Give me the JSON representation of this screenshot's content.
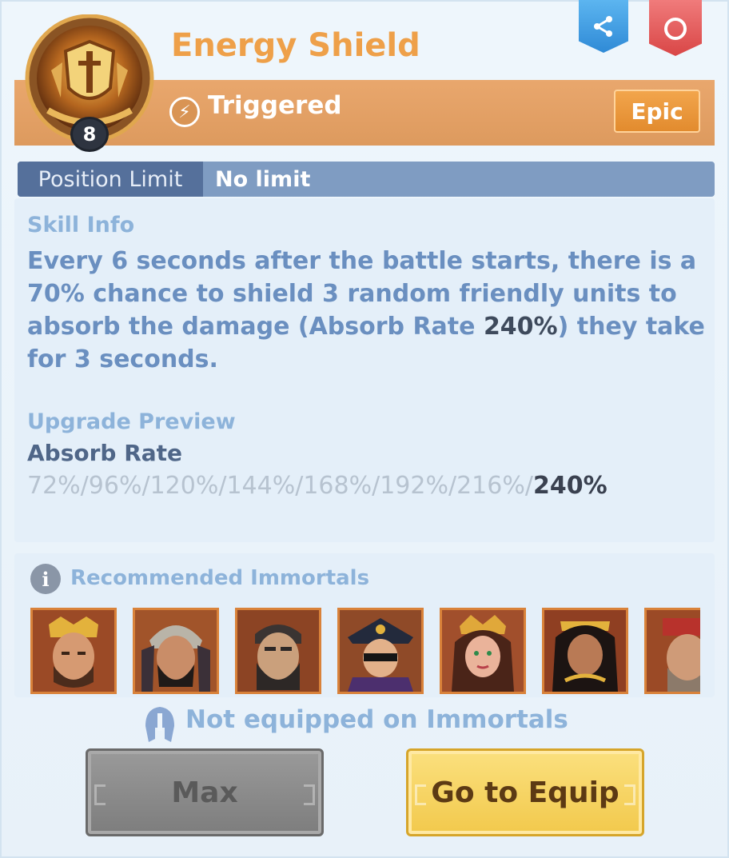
{
  "header": {
    "title": "Energy Shield",
    "trigger_type": "Triggered",
    "rarity": "Epic",
    "level": "8",
    "share_icon": "share-icon",
    "power_icon": "power-icon"
  },
  "position": {
    "label": "Position Limit",
    "value": "No limit"
  },
  "skill_info": {
    "heading": "Skill Info",
    "desc_part1": "Every 6 seconds after the battle starts, there is a 70% chance to shield 3 random friendly units to absorb the damage (Absorb Rate ",
    "desc_highlight": "240%",
    "desc_part2": ") they take for 3 seconds."
  },
  "upgrade": {
    "heading": "Upgrade Preview",
    "stat_name": "Absorb Rate",
    "values_prefix": "72%/96%/120%/144%/168%/192%/216%/",
    "values_final": "240%"
  },
  "recommended": {
    "heading": "Recommended Immortals",
    "portraits": [
      "immortal-1",
      "immortal-2",
      "immortal-3",
      "immortal-4",
      "immortal-5",
      "immortal-6",
      "immortal-7"
    ]
  },
  "footer": {
    "status": "Not equipped on Immortals",
    "max_label": "Max",
    "equip_label": "Go to Equip"
  },
  "colors": {
    "title": "#eea049",
    "band": "#e9a76d",
    "rarity": "#e28b2e",
    "accent_blue": "#8db3da",
    "equip_button": "#f2c94c"
  }
}
